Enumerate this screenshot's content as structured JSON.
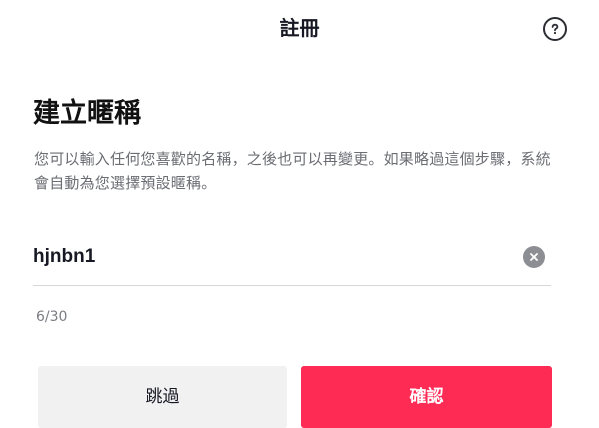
{
  "header": {
    "title": "註冊",
    "help_icon": "question-circle-icon"
  },
  "main": {
    "heading": "建立暱稱",
    "description": "您可以輸入任何您喜歡的名稱，之後也可以再變更。如果略過這個步驟，系統會自動為您選擇預設暱稱。",
    "nickname_value": "hjnbn1",
    "clear_icon": "clear-circle-icon",
    "char_count": "6/30"
  },
  "actions": {
    "skip_label": "跳過",
    "confirm_label": "確認"
  },
  "colors": {
    "primary": "#fe2c55",
    "secondary_button_bg": "#f1f1f2",
    "text_primary": "#161823",
    "text_secondary": "#6b6d73"
  }
}
